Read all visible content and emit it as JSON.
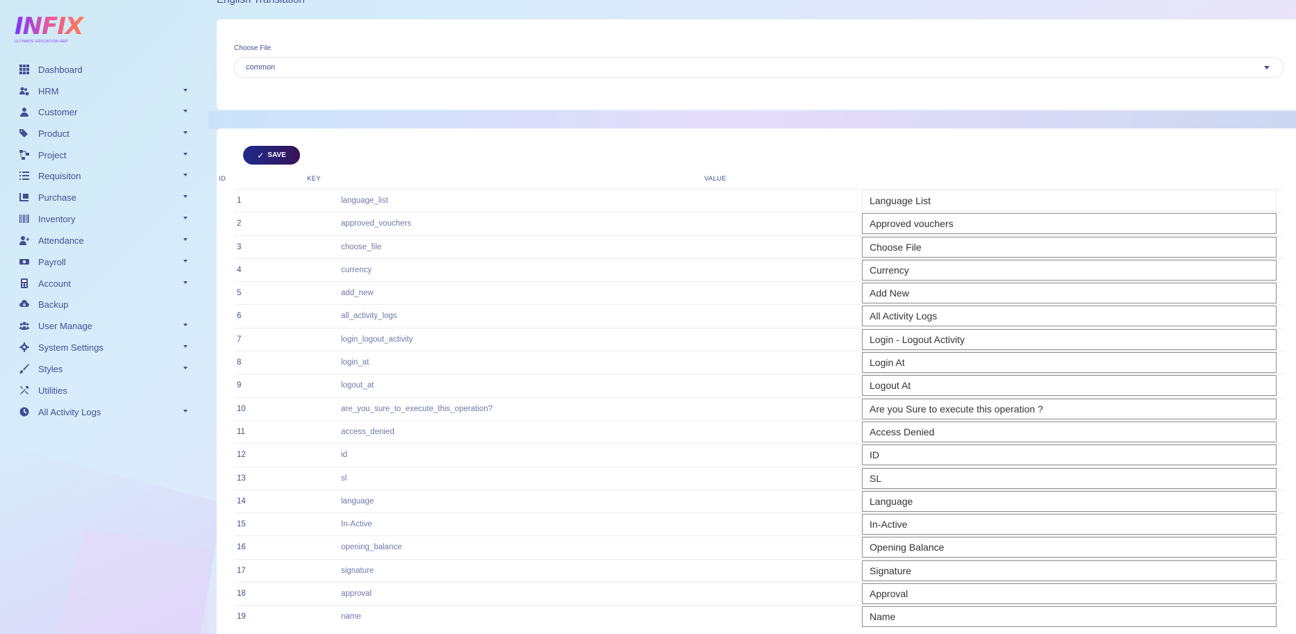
{
  "logo": {
    "title": "INFIX",
    "subtitle": "ULTIMATE EDUCATION ERP"
  },
  "sidebar": {
    "items": [
      {
        "label": "Dashboard",
        "icon": "grid-icon",
        "has_caret": false
      },
      {
        "label": "HRM",
        "icon": "users-cog-icon",
        "has_caret": true
      },
      {
        "label": "Customer",
        "icon": "user-tie-icon",
        "has_caret": true
      },
      {
        "label": "Product",
        "icon": "tags-icon",
        "has_caret": true
      },
      {
        "label": "Project",
        "icon": "project-diagram-icon",
        "has_caret": true
      },
      {
        "label": "Requisiton",
        "icon": "list-icon",
        "has_caret": true
      },
      {
        "label": "Purchase",
        "icon": "dolly-icon",
        "has_caret": true
      },
      {
        "label": "Inventory",
        "icon": "barcode-icon",
        "has_caret": true
      },
      {
        "label": "Attendance",
        "icon": "user-plus-icon",
        "has_caret": true
      },
      {
        "label": "Payroll",
        "icon": "money-bill-icon",
        "has_caret": true
      },
      {
        "label": "Account",
        "icon": "calculator-icon",
        "has_caret": true
      },
      {
        "label": "Backup",
        "icon": "cloud-download-icon",
        "has_caret": false
      },
      {
        "label": "User Manage",
        "icon": "users-icon",
        "has_caret": true
      },
      {
        "label": "System Settings",
        "icon": "gear-icon",
        "has_caret": true
      },
      {
        "label": "Styles",
        "icon": "brush-icon",
        "has_caret": true
      },
      {
        "label": "Utilities",
        "icon": "tools-icon",
        "has_caret": false
      },
      {
        "label": "All Activity Logs",
        "icon": "clock-icon",
        "has_caret": true
      }
    ]
  },
  "page": {
    "title": "English Translation"
  },
  "file_select": {
    "label": "Choose File",
    "value": "common"
  },
  "table": {
    "save_label": "SAVE",
    "headers": {
      "id": "ID",
      "key": "KEY",
      "value": "VALUE"
    },
    "rows": [
      {
        "id": "1",
        "key": "language_list",
        "value": "Language List"
      },
      {
        "id": "2",
        "key": "approved_vouchers",
        "value": "Approved vouchers"
      },
      {
        "id": "3",
        "key": "choose_file",
        "value": "Choose File"
      },
      {
        "id": "4",
        "key": "currency",
        "value": "Currency"
      },
      {
        "id": "5",
        "key": "add_new",
        "value": "Add New"
      },
      {
        "id": "6",
        "key": "all_activity_logs",
        "value": "All Activity Logs"
      },
      {
        "id": "7",
        "key": "login_logout_activity",
        "value": "Login - Logout Activity"
      },
      {
        "id": "8",
        "key": "login_at",
        "value": "Login At"
      },
      {
        "id": "9",
        "key": "logout_at",
        "value": "Logout At"
      },
      {
        "id": "10",
        "key": "are_you_sure_to_execute_this_operation?",
        "value": "Are you Sure to execute this operation ?"
      },
      {
        "id": "11",
        "key": "access_denied",
        "value": "Access Denied"
      },
      {
        "id": "12",
        "key": "id",
        "value": "ID"
      },
      {
        "id": "13",
        "key": "sl",
        "value": "SL"
      },
      {
        "id": "14",
        "key": "language",
        "value": "Language"
      },
      {
        "id": "15",
        "key": "In-Active",
        "value": "In-Active"
      },
      {
        "id": "16",
        "key": "opening_balance",
        "value": "Opening Balance"
      },
      {
        "id": "17",
        "key": "signature",
        "value": "Signature"
      },
      {
        "id": "18",
        "key": "approval",
        "value": "Approval"
      },
      {
        "id": "19",
        "key": "name",
        "value": "Name"
      }
    ]
  },
  "colors": {
    "primary_text": "#415094",
    "save_gradient_start": "#1f2a8a",
    "save_gradient_end": "#3a1155",
    "brand_purple": "#7c32ff"
  }
}
